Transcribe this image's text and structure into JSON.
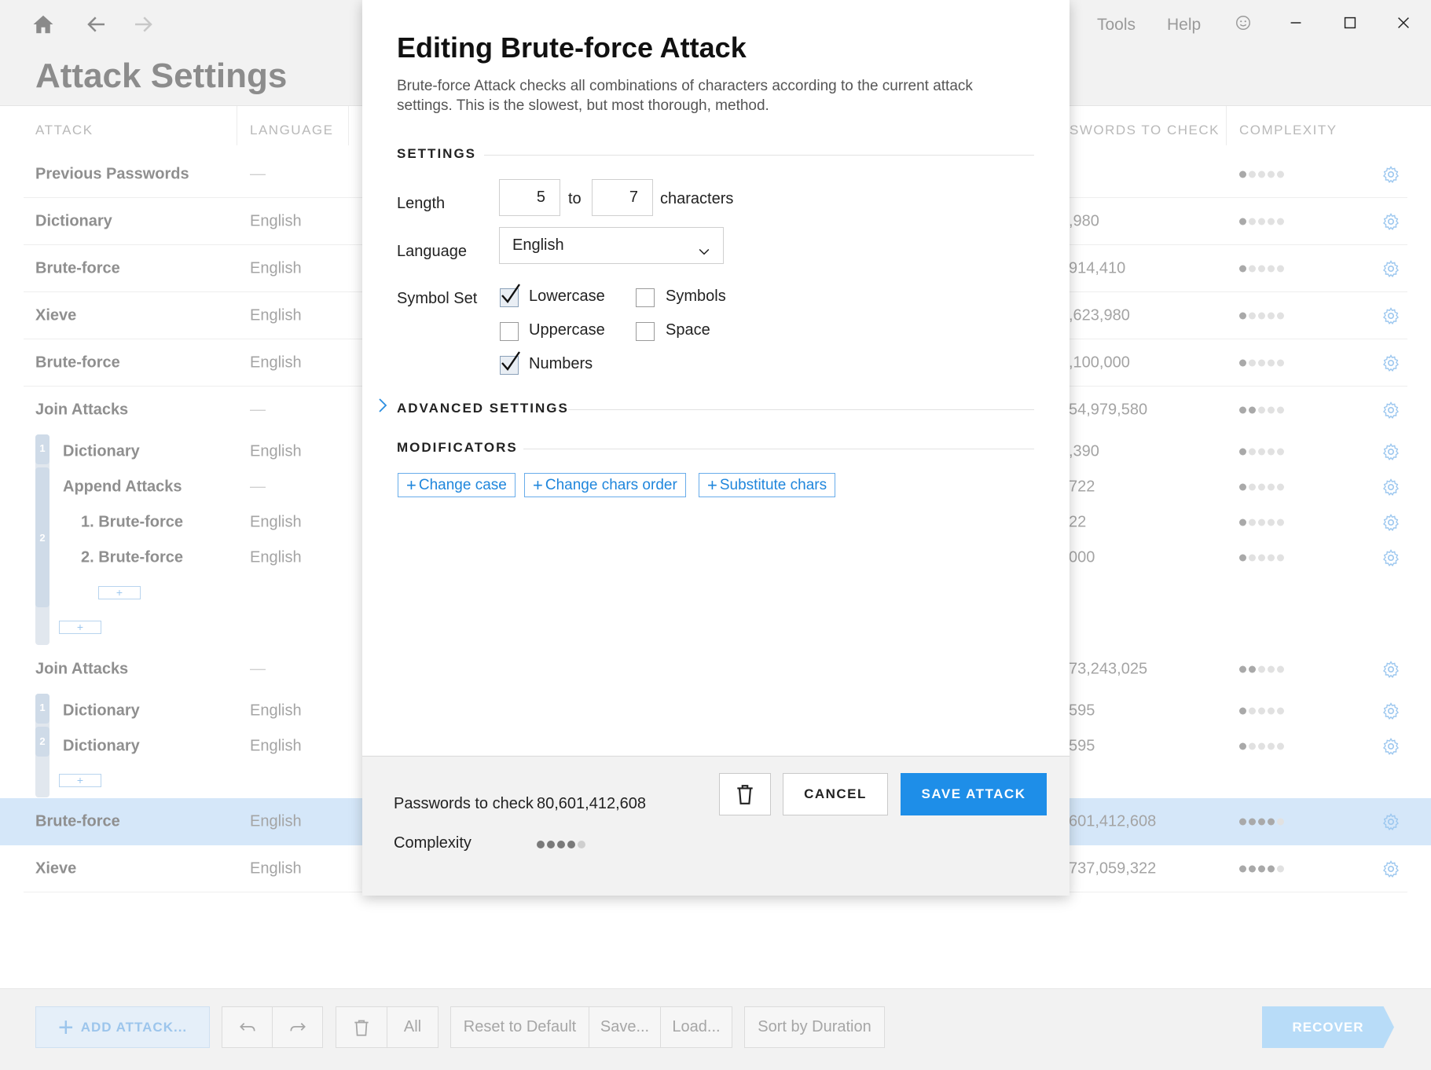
{
  "window": {
    "title": "Attack Settings",
    "menu": [
      "Tools",
      "Help"
    ],
    "icons": {
      "home": "home-icon",
      "back": "arrow-left-icon",
      "forward": "arrow-right-icon",
      "feedback": "smiley-icon",
      "minimize": "minimize-icon",
      "maximize": "maximize-icon",
      "close": "close-icon"
    }
  },
  "table": {
    "columns": [
      "ATTACK",
      "LANGUAGE",
      "PASSWORDS TO CHECK",
      "COMPLEXITY"
    ],
    "columns_visible": [
      "ATTACK",
      "LANGUAGE",
      "SWORDS TO CHECK",
      "COMPLEXITY"
    ],
    "rows": [
      {
        "name": "Previous Passwords",
        "language": "—",
        "count": "",
        "complexity": 1
      },
      {
        "name": "Dictionary",
        "language": "English",
        "count": ",980",
        "complexity": 1
      },
      {
        "name": "Brute-force",
        "language": "English",
        "count": "914,410",
        "complexity": 1
      },
      {
        "name": "Xieve",
        "language": "English",
        "count": ",623,980",
        "complexity": 1
      },
      {
        "name": "Brute-force",
        "language": "English",
        "count": ",100,000",
        "complexity": 1
      },
      {
        "name": "Join Attacks",
        "language": "—",
        "count": "54,979,580",
        "complexity": 2
      },
      {
        "name": "Dictionary",
        "language": "English",
        "count": ",390",
        "complexity": 1
      },
      {
        "name": "Append Attacks",
        "language": "—",
        "count": "722",
        "complexity": 1
      },
      {
        "name": "1. Brute-force",
        "language": "English",
        "count": "22",
        "complexity": 1
      },
      {
        "name": "2. Brute-force",
        "language": "English",
        "count": "000",
        "complexity": 1
      },
      {
        "name": "Join Attacks",
        "language": "—",
        "count": "73,243,025",
        "complexity": 2
      },
      {
        "name": "Dictionary",
        "language": "English",
        "count": "595",
        "complexity": 1
      },
      {
        "name": "Dictionary",
        "language": "English",
        "count": "595",
        "complexity": 1
      },
      {
        "name": "Brute-force",
        "language": "English",
        "count": "601,412,608",
        "complexity": 4
      },
      {
        "name": "Xieve",
        "language": "English",
        "count": "737,059,322",
        "complexity": 4
      }
    ],
    "bracket_numbers": [
      "1",
      "2",
      "1",
      "2"
    ],
    "add_symbol": "+"
  },
  "toolbar": {
    "add_attack": "ADD ATTACK...",
    "all": "All",
    "reset": "Reset to Default",
    "save": "Save...",
    "load": "Load...",
    "sort": "Sort by Duration",
    "recover": "RECOVER"
  },
  "dialog": {
    "title": "Editing Brute-force Attack",
    "description": "Brute-force Attack checks all combinations of characters according to the current attack settings. This is the slowest, but most thorough, method.",
    "settings_header": "SETTINGS",
    "length_label": "Length",
    "length_from": "5",
    "length_to_word": "to",
    "length_to": "7",
    "length_unit": "characters",
    "language_label": "Language",
    "language_value": "English",
    "symbol_set_label": "Symbol Set",
    "symbols": {
      "lowercase": {
        "label": "Lowercase",
        "checked": true
      },
      "uppercase": {
        "label": "Uppercase",
        "checked": false
      },
      "numbers": {
        "label": "Numbers",
        "checked": true
      },
      "symbols": {
        "label": "Symbols",
        "checked": false
      },
      "space": {
        "label": "Space",
        "checked": false
      }
    },
    "advanced_header": "ADVANCED SETTINGS",
    "modificators_header": "MODIFICATORS",
    "modificators": [
      "Change case",
      "Change chars order",
      "Substitute chars"
    ],
    "footer": {
      "passwords_label": "Passwords to check",
      "passwords_value": "80,601,412,608",
      "complexity_label": "Complexity",
      "complexity_level": 4,
      "complexity_max": 5,
      "cancel": "CANCEL",
      "save": "SAVE ATTACK"
    }
  },
  "colors": {
    "accent": "#1e8ee8",
    "selected_row": "#d5e7f9",
    "link_blue": "#1f86dc"
  }
}
